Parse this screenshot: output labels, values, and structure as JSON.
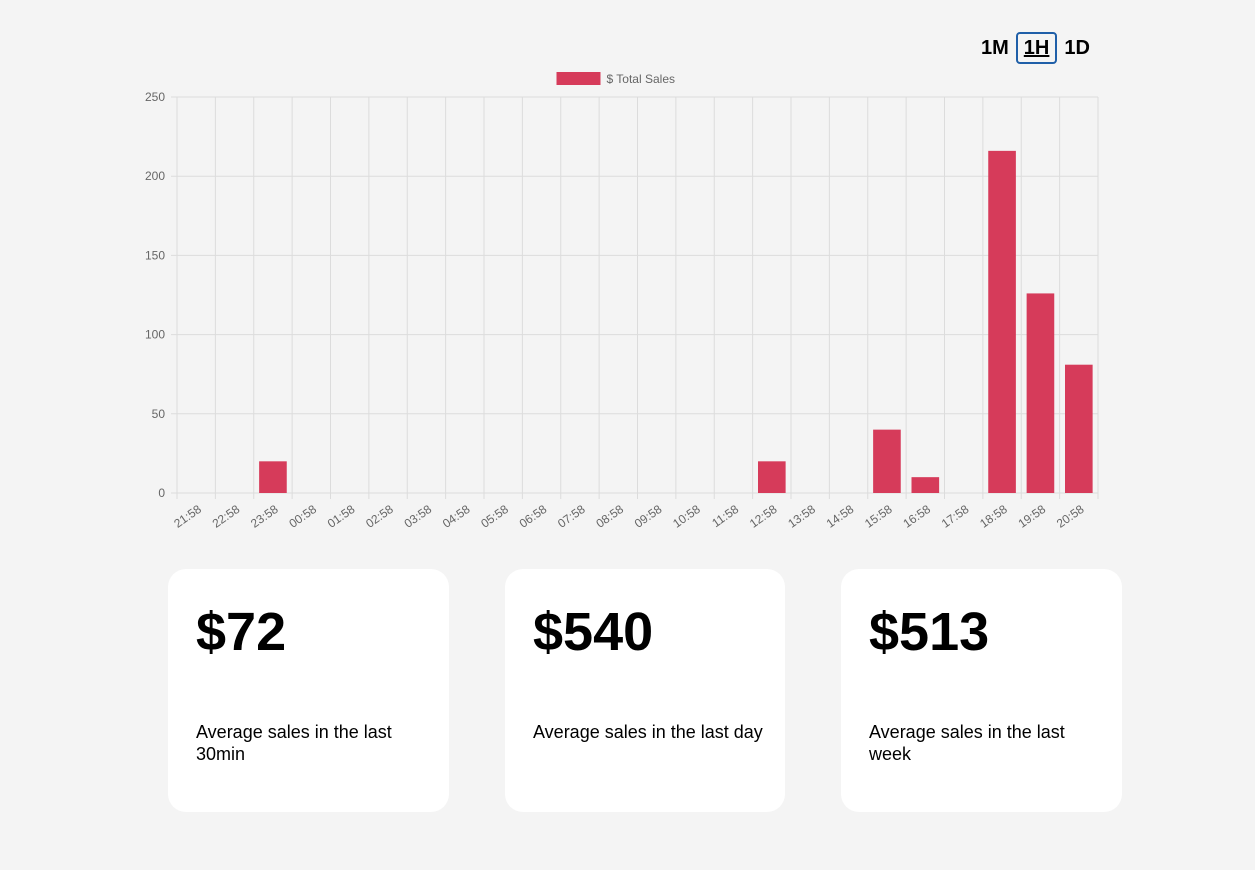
{
  "range_switch": {
    "options": [
      {
        "label": "1M",
        "active": false
      },
      {
        "label": "1H",
        "active": true
      },
      {
        "label": "1D",
        "active": false
      }
    ]
  },
  "chart_data": {
    "type": "bar",
    "legend": {
      "label": "$ Total Sales",
      "position": "top",
      "color": "#d63b5a"
    },
    "categories": [
      "21:58",
      "22:58",
      "23:58",
      "00:58",
      "01:58",
      "02:58",
      "03:58",
      "04:58",
      "05:58",
      "06:58",
      "07:58",
      "08:58",
      "09:58",
      "10:58",
      "11:58",
      "12:58",
      "13:58",
      "14:58",
      "15:58",
      "16:58",
      "17:58",
      "18:58",
      "19:58",
      "20:58"
    ],
    "series": [
      {
        "name": "$ Total Sales",
        "values": [
          0,
          0,
          20,
          0,
          0,
          0,
          0,
          0,
          0,
          0,
          0,
          0,
          0,
          0,
          0,
          20,
          0,
          0,
          40,
          10,
          0,
          216,
          126,
          81
        ]
      }
    ],
    "ylim": [
      0,
      250
    ],
    "yticks": [
      0,
      50,
      100,
      150,
      200,
      250
    ],
    "grid": true,
    "xlabel": "",
    "ylabel": "",
    "colors": {
      "bar": "#d63b5a",
      "grid": "#dcdcdc",
      "tick_text": "#666666"
    }
  },
  "cards": [
    {
      "value": "$72",
      "label": "Average sales in the last 30min"
    },
    {
      "value": "$540",
      "label": "Average sales in the last day"
    },
    {
      "value": "$513",
      "label": "Average sales in the last week"
    }
  ]
}
